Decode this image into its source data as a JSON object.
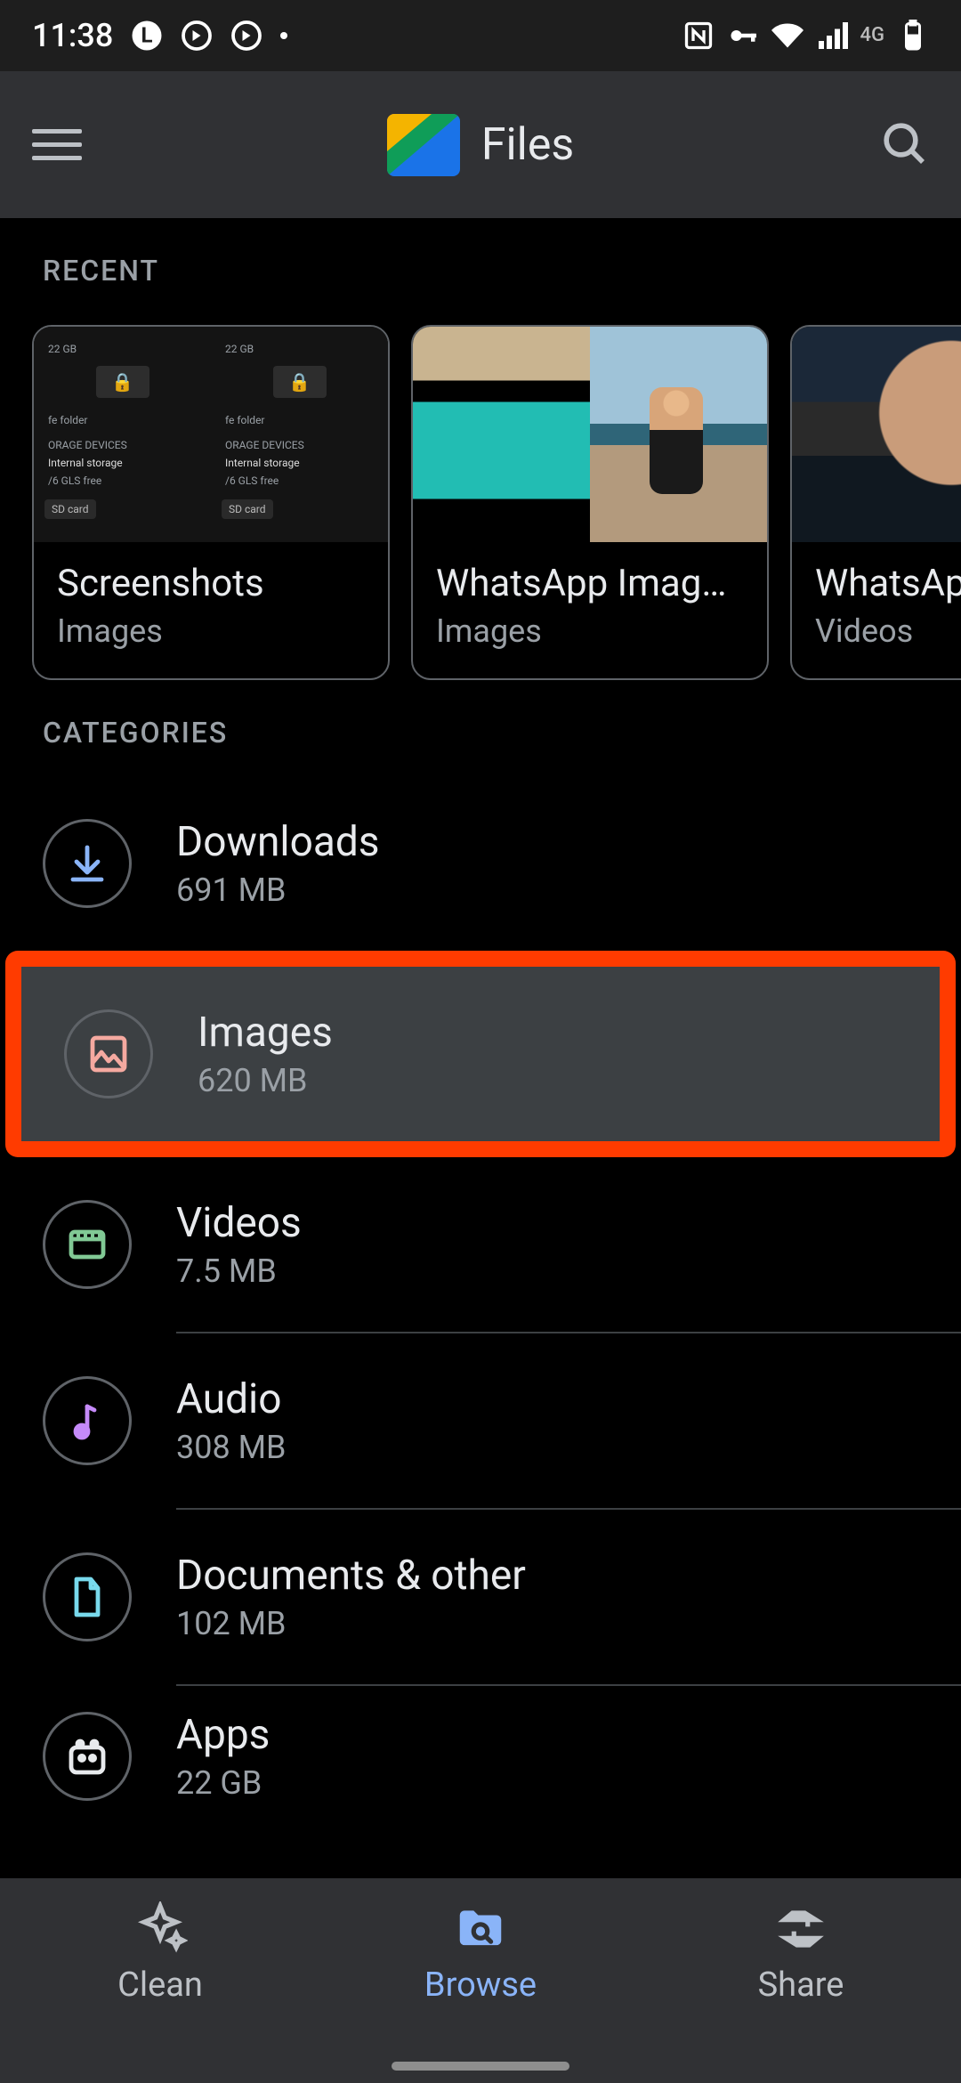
{
  "status": {
    "time": "11:38",
    "network_label": "4G"
  },
  "appbar": {
    "title": "Files"
  },
  "recent": {
    "section_title": "RECENT",
    "cards": [
      {
        "name": "Screenshots",
        "kind": "Images"
      },
      {
        "name": "WhatsApp Imag…",
        "kind": "Images"
      },
      {
        "name": "WhatsAp",
        "kind": "Videos"
      }
    ]
  },
  "categories": {
    "section_title": "CATEGORIES",
    "items": [
      {
        "name": "Downloads",
        "size": "691 MB"
      },
      {
        "name": "Images",
        "size": "620 MB"
      },
      {
        "name": "Videos",
        "size": "7.5 MB"
      },
      {
        "name": "Audio",
        "size": "308 MB"
      },
      {
        "name": "Documents & other",
        "size": "102 MB"
      },
      {
        "name": "Apps",
        "size": "22 GB"
      }
    ]
  },
  "nav": {
    "clean": "Clean",
    "browse": "Browse",
    "share": "Share"
  },
  "thumb1": {
    "top": "22 GB",
    "folder": "fe folder",
    "devices": "ORAGE DEVICES",
    "internal": "Internal storage",
    "free": "/6 GLS free",
    "sd": "SD card"
  }
}
